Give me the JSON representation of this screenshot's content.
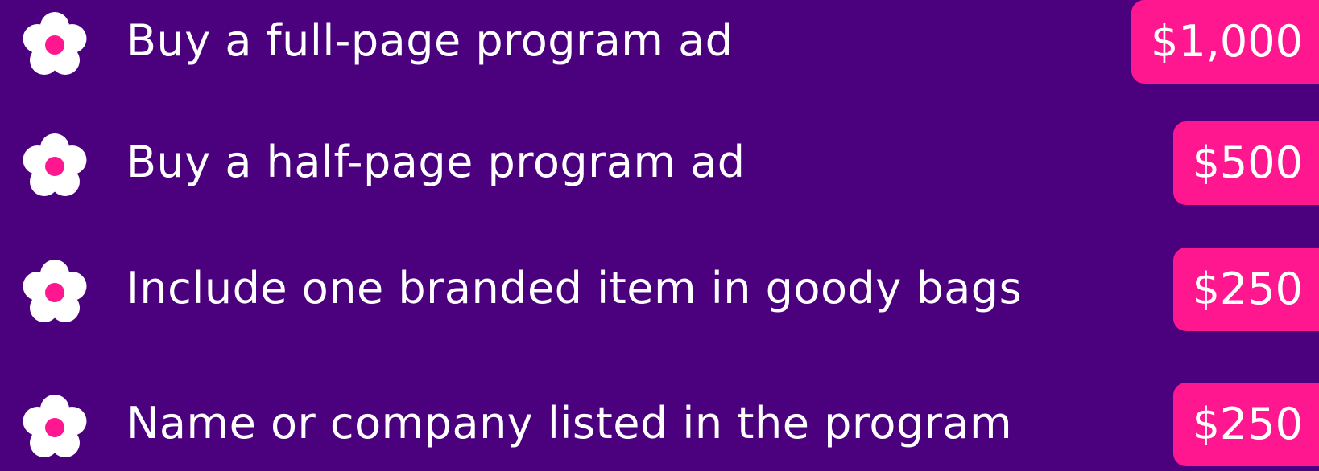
{
  "colors": {
    "background": "#4b007d",
    "accent": "#ff178f",
    "text": "#ffffff",
    "flower_petals": "#ffffff",
    "flower_center": "#ff178f"
  },
  "icon": "flower-icon",
  "items": [
    {
      "label": "Buy a full-page program ad",
      "price": "$1,000"
    },
    {
      "label": "Buy a half-page program ad",
      "price": "$500"
    },
    {
      "label": "Include one branded item in goody bags",
      "price": "$250"
    },
    {
      "label": "Name or company listed in the program",
      "price": "$250"
    }
  ]
}
